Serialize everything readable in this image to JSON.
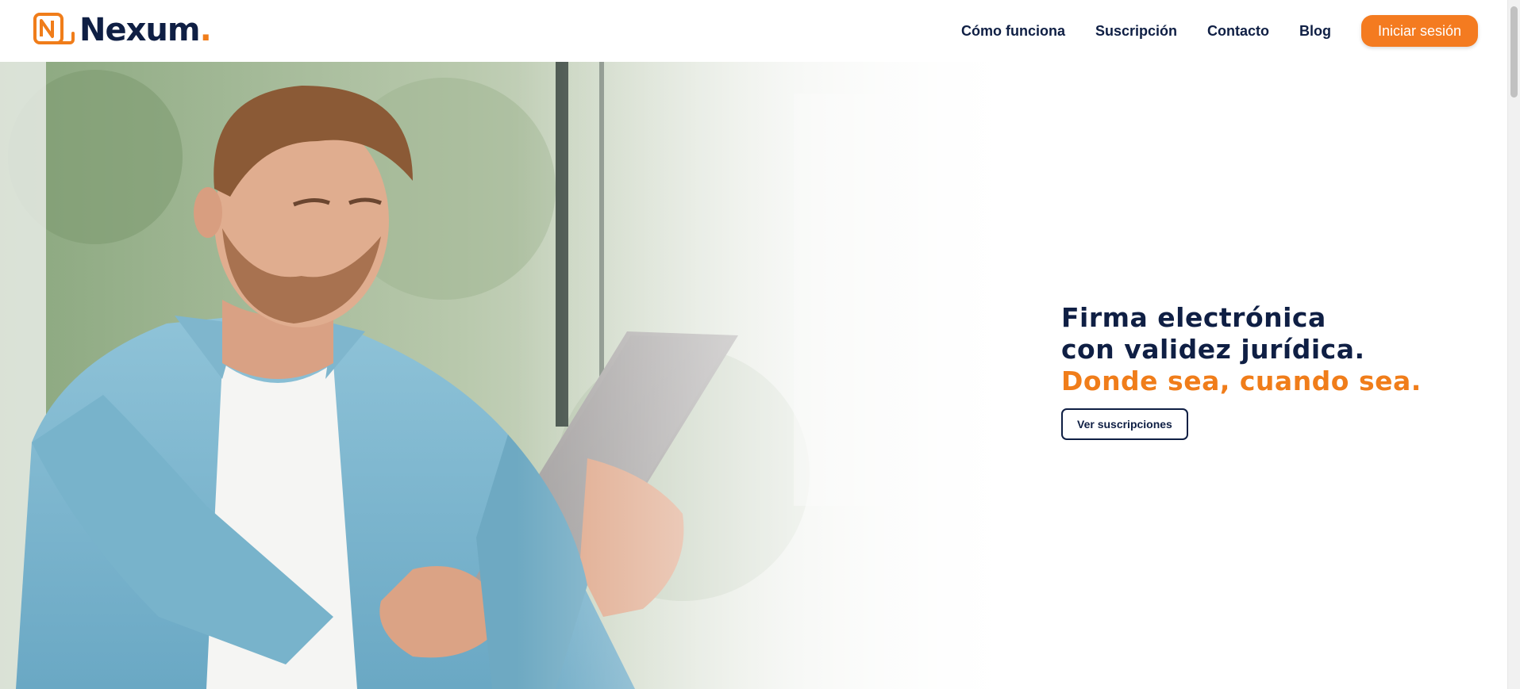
{
  "brand": {
    "name": "Nexum",
    "dot": ".",
    "accent_color": "#f07d1a",
    "primary_color": "#0f1f44"
  },
  "nav": {
    "items": [
      {
        "label": "Cómo funciona"
      },
      {
        "label": "Suscripción"
      },
      {
        "label": "Contacto"
      },
      {
        "label": "Blog"
      }
    ],
    "login_label": "Iniciar sesión"
  },
  "hero": {
    "image": "man-with-tablet-photo",
    "headline_line1": "Firma electrónica",
    "headline_line2": "con validez jurídica.",
    "headline_accent": "Donde sea, cuando sea.",
    "cta_label": "Ver suscripciones"
  }
}
